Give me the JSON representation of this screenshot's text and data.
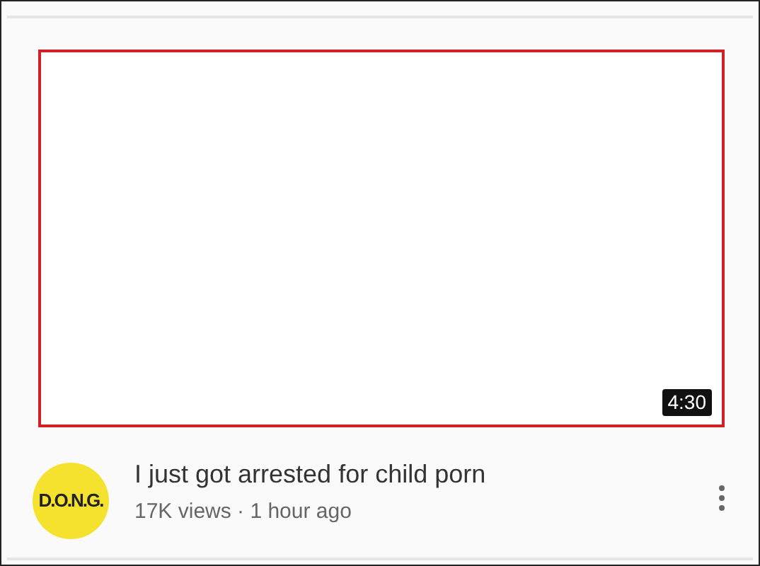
{
  "video": {
    "duration": "4:30",
    "channel_logo": "D.O.N.G.",
    "title": "I just got arrested for child porn",
    "meta": "17K views · 1 hour ago"
  }
}
